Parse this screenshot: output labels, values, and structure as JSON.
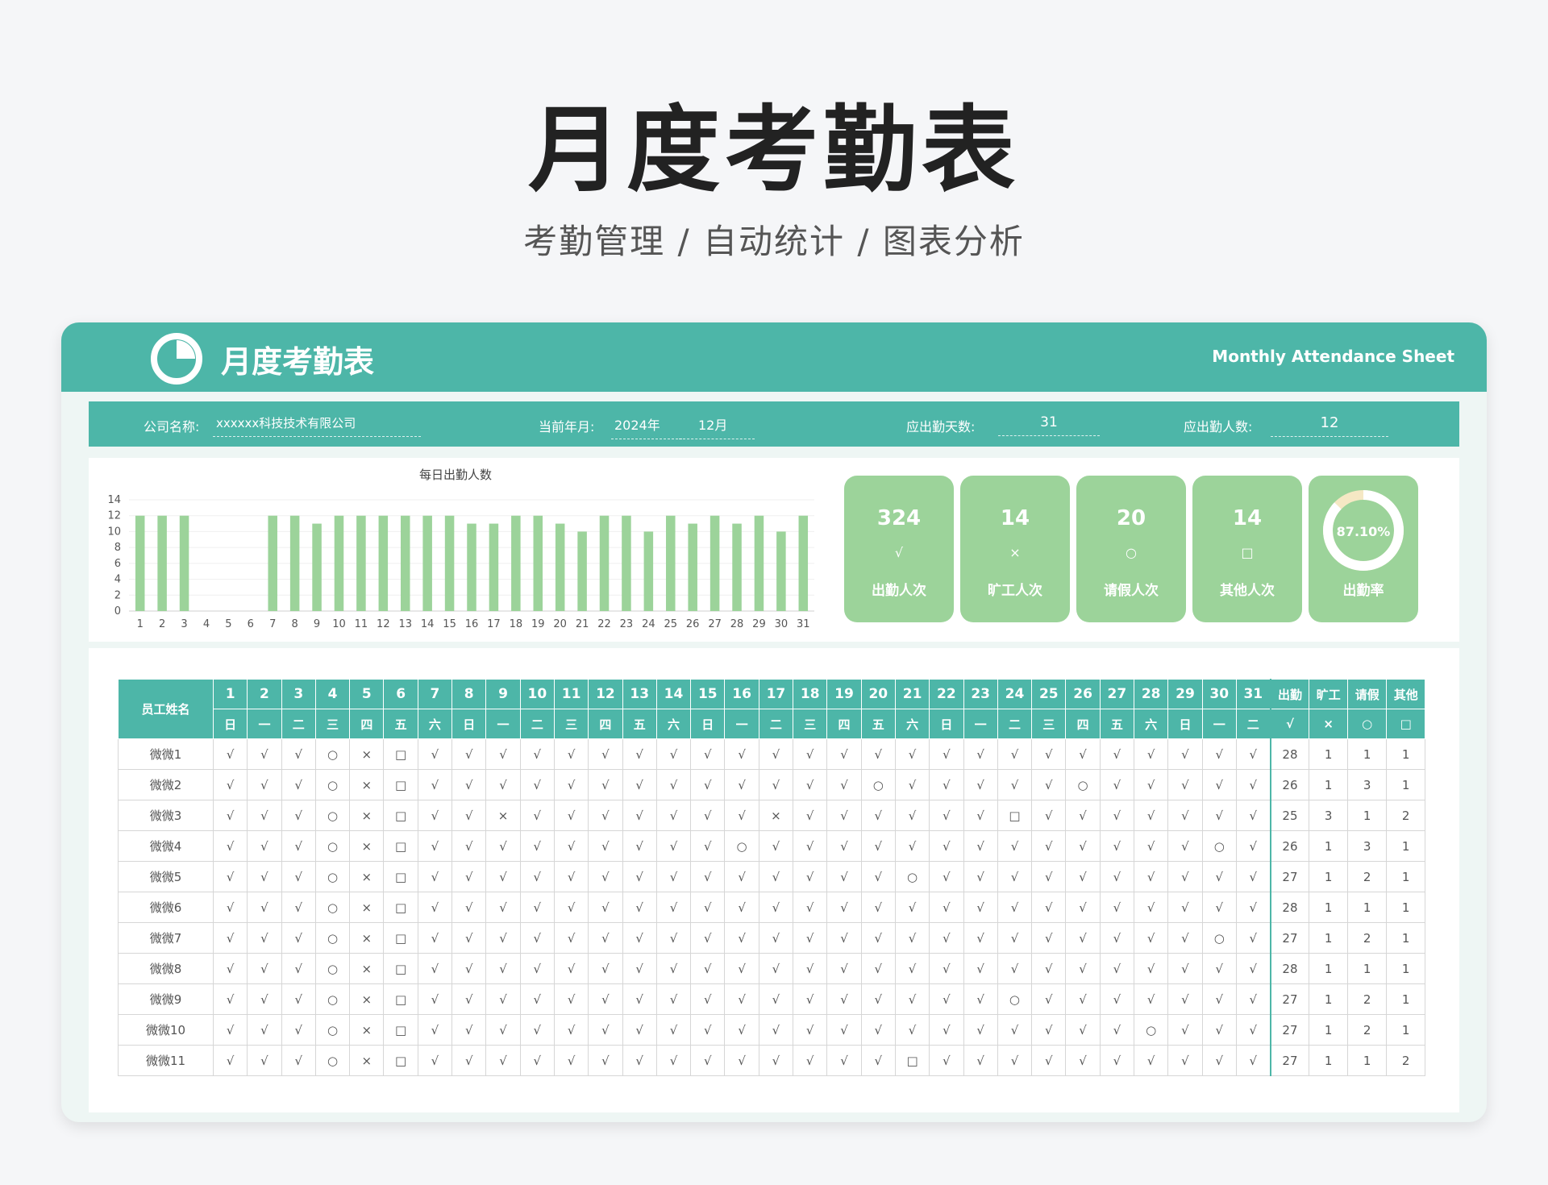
{
  "hero": {
    "title": "月度考勤表",
    "subtitle": "考勤管理 / 自动统计 / 图表分析"
  },
  "header": {
    "title": "月度考勤表",
    "subtitle_en": "Monthly Attendance Sheet",
    "logo_icon": "pie-chart-icon"
  },
  "info": {
    "company_label": "公司名称:",
    "company_value": "xxxxxx科技技术有限公司",
    "period_label": "当前年月:",
    "year_value": "2024年",
    "month_value": "12月",
    "days_label": "应出勤天数:",
    "days_value": "31",
    "people_label": "应出勤人数:",
    "people_value": "12"
  },
  "chart_data": {
    "type": "bar",
    "title": "每日出勤人数",
    "categories": [
      "1",
      "2",
      "3",
      "4",
      "5",
      "6",
      "7",
      "8",
      "9",
      "10",
      "11",
      "12",
      "13",
      "14",
      "15",
      "16",
      "17",
      "18",
      "19",
      "20",
      "21",
      "22",
      "23",
      "24",
      "25",
      "26",
      "27",
      "28",
      "29",
      "30",
      "31"
    ],
    "values": [
      12,
      12,
      12,
      0,
      0,
      0,
      12,
      12,
      11,
      12,
      12,
      12,
      12,
      12,
      12,
      11,
      11,
      12,
      12,
      11,
      10,
      12,
      12,
      10,
      12,
      11,
      12,
      11,
      12,
      10,
      12
    ],
    "ylim": [
      0,
      14
    ],
    "yticks": [
      "0",
      "2",
      "4",
      "6",
      "8",
      "10",
      "12",
      "14"
    ],
    "bar_color": "#9cd39a",
    "grid": true
  },
  "kpis": [
    {
      "value": "324",
      "symbol": "√",
      "label": "出勤人次"
    },
    {
      "value": "14",
      "symbol": "×",
      "label": "旷工人次"
    },
    {
      "value": "20",
      "symbol": "○",
      "label": "请假人次"
    },
    {
      "value": "14",
      "symbol": "□",
      "label": "其他人次"
    }
  ],
  "rate": {
    "value": "87.10%",
    "label": "出勤率",
    "fraction": 0.871
  },
  "table": {
    "name_header": "员工姓名",
    "days": [
      "1",
      "2",
      "3",
      "4",
      "5",
      "6",
      "7",
      "8",
      "9",
      "10",
      "11",
      "12",
      "13",
      "14",
      "15",
      "16",
      "17",
      "18",
      "19",
      "20",
      "21",
      "22",
      "23",
      "24",
      "25",
      "26",
      "27",
      "28",
      "29",
      "30",
      "31"
    ],
    "weekdays": [
      "日",
      "一",
      "二",
      "三",
      "四",
      "五",
      "六",
      "日",
      "一",
      "二",
      "三",
      "四",
      "五",
      "六",
      "日",
      "一",
      "二",
      "三",
      "四",
      "五",
      "六",
      "日",
      "一",
      "二",
      "三",
      "四",
      "五",
      "六",
      "日",
      "一",
      "二"
    ],
    "summary_headers": [
      "出勤",
      "旷工",
      "请假",
      "其他"
    ],
    "summary_symbols": [
      "√",
      "×",
      "○",
      "□"
    ],
    "rows": [
      {
        "name": "微微1",
        "marks": [
          "√",
          "√",
          "√",
          "○",
          "×",
          "□",
          "√",
          "√",
          "√",
          "√",
          "√",
          "√",
          "√",
          "√",
          "√",
          "√",
          "√",
          "√",
          "√",
          "√",
          "√",
          "√",
          "√",
          "√",
          "√",
          "√",
          "√",
          "√",
          "√",
          "√",
          "√"
        ],
        "stats": [
          "28",
          "1",
          "1",
          "1"
        ]
      },
      {
        "name": "微微2",
        "marks": [
          "√",
          "√",
          "√",
          "○",
          "×",
          "□",
          "√",
          "√",
          "√",
          "√",
          "√",
          "√",
          "√",
          "√",
          "√",
          "√",
          "√",
          "√",
          "√",
          "○",
          "√",
          "√",
          "√",
          "√",
          "√",
          "○",
          "√",
          "√",
          "√",
          "√",
          "√"
        ],
        "stats": [
          "26",
          "1",
          "3",
          "1"
        ]
      },
      {
        "name": "微微3",
        "marks": [
          "√",
          "√",
          "√",
          "○",
          "×",
          "□",
          "√",
          "√",
          "×",
          "√",
          "√",
          "√",
          "√",
          "√",
          "√",
          "√",
          "×",
          "√",
          "√",
          "√",
          "√",
          "√",
          "√",
          "□",
          "√",
          "√",
          "√",
          "√",
          "√",
          "√",
          "√"
        ],
        "stats": [
          "25",
          "3",
          "1",
          "2"
        ]
      },
      {
        "name": "微微4",
        "marks": [
          "√",
          "√",
          "√",
          "○",
          "×",
          "□",
          "√",
          "√",
          "√",
          "√",
          "√",
          "√",
          "√",
          "√",
          "√",
          "○",
          "√",
          "√",
          "√",
          "√",
          "√",
          "√",
          "√",
          "√",
          "√",
          "√",
          "√",
          "√",
          "√",
          "○",
          "√"
        ],
        "stats": [
          "26",
          "1",
          "3",
          "1"
        ]
      },
      {
        "name": "微微5",
        "marks": [
          "√",
          "√",
          "√",
          "○",
          "×",
          "□",
          "√",
          "√",
          "√",
          "√",
          "√",
          "√",
          "√",
          "√",
          "√",
          "√",
          "√",
          "√",
          "√",
          "√",
          "○",
          "√",
          "√",
          "√",
          "√",
          "√",
          "√",
          "√",
          "√",
          "√",
          "√"
        ],
        "stats": [
          "27",
          "1",
          "2",
          "1"
        ]
      },
      {
        "name": "微微6",
        "marks": [
          "√",
          "√",
          "√",
          "○",
          "×",
          "□",
          "√",
          "√",
          "√",
          "√",
          "√",
          "√",
          "√",
          "√",
          "√",
          "√",
          "√",
          "√",
          "√",
          "√",
          "√",
          "√",
          "√",
          "√",
          "√",
          "√",
          "√",
          "√",
          "√",
          "√",
          "√"
        ],
        "stats": [
          "28",
          "1",
          "1",
          "1"
        ]
      },
      {
        "name": "微微7",
        "marks": [
          "√",
          "√",
          "√",
          "○",
          "×",
          "□",
          "√",
          "√",
          "√",
          "√",
          "√",
          "√",
          "√",
          "√",
          "√",
          "√",
          "√",
          "√",
          "√",
          "√",
          "√",
          "√",
          "√",
          "√",
          "√",
          "√",
          "√",
          "√",
          "√",
          "○",
          "√"
        ],
        "stats": [
          "27",
          "1",
          "2",
          "1"
        ]
      },
      {
        "name": "微微8",
        "marks": [
          "√",
          "√",
          "√",
          "○",
          "×",
          "□",
          "√",
          "√",
          "√",
          "√",
          "√",
          "√",
          "√",
          "√",
          "√",
          "√",
          "√",
          "√",
          "√",
          "√",
          "√",
          "√",
          "√",
          "√",
          "√",
          "√",
          "√",
          "√",
          "√",
          "√",
          "√"
        ],
        "stats": [
          "28",
          "1",
          "1",
          "1"
        ]
      },
      {
        "name": "微微9",
        "marks": [
          "√",
          "√",
          "√",
          "○",
          "×",
          "□",
          "√",
          "√",
          "√",
          "√",
          "√",
          "√",
          "√",
          "√",
          "√",
          "√",
          "√",
          "√",
          "√",
          "√",
          "√",
          "√",
          "√",
          "○",
          "√",
          "√",
          "√",
          "√",
          "√",
          "√",
          "√"
        ],
        "stats": [
          "27",
          "1",
          "2",
          "1"
        ]
      },
      {
        "name": "微微10",
        "marks": [
          "√",
          "√",
          "√",
          "○",
          "×",
          "□",
          "√",
          "√",
          "√",
          "√",
          "√",
          "√",
          "√",
          "√",
          "√",
          "√",
          "√",
          "√",
          "√",
          "√",
          "√",
          "√",
          "√",
          "√",
          "√",
          "√",
          "√",
          "○",
          "√",
          "√",
          "√"
        ],
        "stats": [
          "27",
          "1",
          "2",
          "1"
        ]
      },
      {
        "name": "微微11",
        "marks": [
          "√",
          "√",
          "√",
          "○",
          "×",
          "□",
          "√",
          "√",
          "√",
          "√",
          "√",
          "√",
          "√",
          "√",
          "√",
          "√",
          "√",
          "√",
          "√",
          "√",
          "□",
          "√",
          "√",
          "√",
          "√",
          "√",
          "√",
          "√",
          "√",
          "√",
          "√"
        ],
        "stats": [
          "27",
          "1",
          "1",
          "2"
        ]
      }
    ]
  },
  "colors": {
    "primary": "#4db6a8",
    "kpi_green": "#9cd39a",
    "ring_track": "#f5e8c4",
    "ring_fill": "#ffffff"
  }
}
